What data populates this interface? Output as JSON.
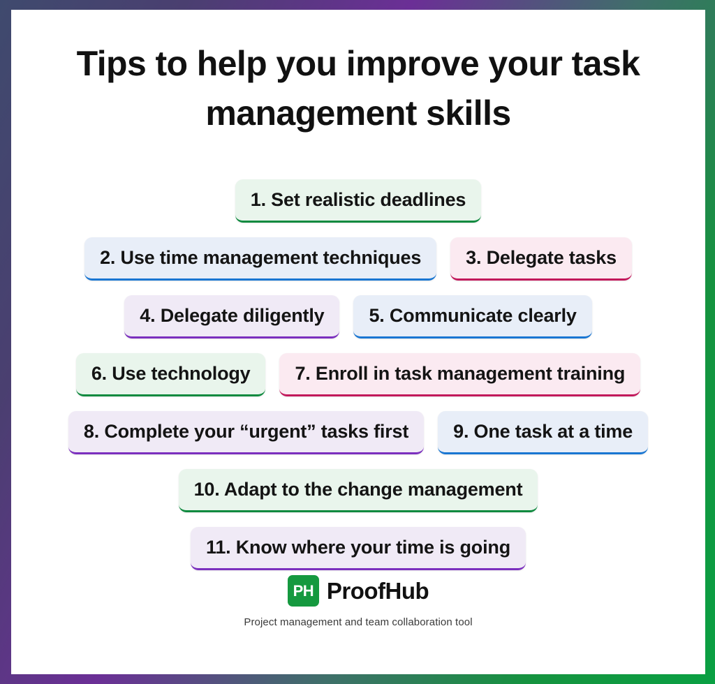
{
  "headline": "Tips to help you improve your task management skills",
  "tips": {
    "rows": [
      {
        "items": [
          {
            "text": "1. Set realistic deadlines",
            "color": "green",
            "accent": "#0f8a3f"
          }
        ]
      },
      {
        "items": [
          {
            "text": "2. Use time management techniques",
            "color": "blue",
            "accent": "#1976d2"
          },
          {
            "text": "3. Delegate tasks",
            "color": "pink",
            "accent": "#c2185b"
          }
        ]
      },
      {
        "items": [
          {
            "text": "4. Delegate diligently",
            "color": "purple",
            "accent": "#7b2fbe"
          },
          {
            "text": "5. Communicate clearly",
            "color": "blue",
            "accent": "#1976d2"
          }
        ]
      },
      {
        "items": [
          {
            "text": "6. Use technology",
            "color": "green",
            "accent": "#0f8a3f"
          },
          {
            "text": "7. Enroll in task management training",
            "color": "pink",
            "accent": "#c2185b"
          }
        ]
      },
      {
        "items": [
          {
            "text": "8. Complete your “urgent” tasks first",
            "color": "purple",
            "accent": "#7b2fbe"
          },
          {
            "text": "9. One task at a time",
            "color": "blue",
            "accent": "#1976d2"
          }
        ]
      },
      {
        "items": [
          {
            "text": "10. Adapt to the change management",
            "color": "green",
            "accent": "#0f8a3f"
          }
        ]
      },
      {
        "items": [
          {
            "text": "11. Know where your time is going",
            "color": "purple",
            "accent": "#7b2fbe"
          }
        ]
      }
    ]
  },
  "brand": {
    "mark_text": "PH",
    "mark_color": "#15993f",
    "name": "ProofHub",
    "tagline": "Project management and team collaboration tool"
  },
  "frame": {
    "gradient_start": "#3f4a6e",
    "gradient_mid": "#6b2f96",
    "gradient_end": "#0aa043"
  }
}
